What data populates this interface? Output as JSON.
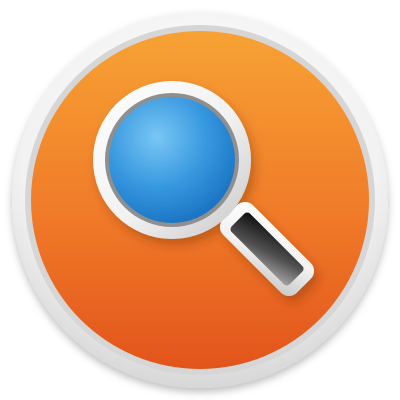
{
  "icon": {
    "name": "magnifying-glass-app-icon",
    "glyph": "magnifier-icon"
  },
  "colors": {
    "background": "#ffffff",
    "outer_ring_light": "#f7f7f7",
    "outer_ring_shadow": "#c9c9c9",
    "orange_light": "#f6962f",
    "orange_dark": "#e5571c",
    "lens_blue_light": "#61b7ef",
    "lens_blue_dark": "#1a79c8",
    "frame_light": "#ffffff",
    "frame_shadow": "#9c9c9c",
    "handle_dark": "#141414",
    "handle_light": "#9a9a9a"
  }
}
